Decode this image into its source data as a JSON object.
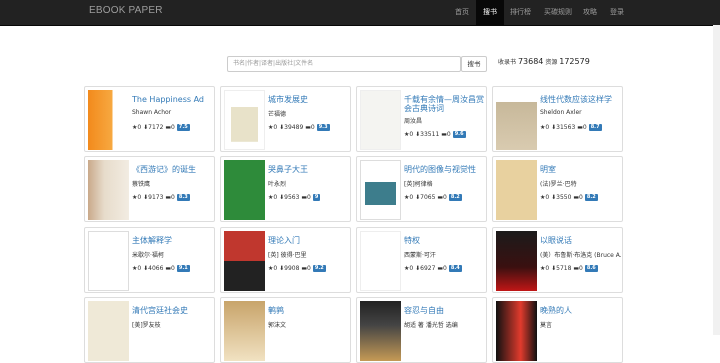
{
  "brand": "EBOOK   PAPER",
  "nav": [
    "首页",
    "搜书",
    "排行榜",
    "买碳规则",
    "攻略",
    "登录"
  ],
  "search": {
    "placeholder": "书名|作者|译者|出版社|文件名",
    "button": "搜书"
  },
  "stats": {
    "books_label": "收录书",
    "books": "73684",
    "resources_label": "资源",
    "resources": "172579"
  },
  "books": [
    {
      "title": "The Happiness Ad",
      "author": "Shawn Achor",
      "stars": "0",
      "downloads": "7172",
      "comments": "0",
      "score": "7.5"
    },
    {
      "title": "城市发展史",
      "author": "芒福德",
      "stars": "0",
      "downloads": "39489",
      "comments": "0",
      "score": "9.3"
    },
    {
      "title": "千载有余情—周汝昌赏会古典诗词",
      "author": "周汝昌",
      "stars": "0",
      "downloads": "33511",
      "comments": "0",
      "score": "9.6"
    },
    {
      "title": "线性代数应该这样学",
      "author": "Sheldon Axler",
      "stars": "0",
      "downloads": "31563",
      "comments": "0",
      "score": "8.7"
    },
    {
      "title": "《西游记》的诞生",
      "author": "蔡铁鹰",
      "stars": "0",
      "downloads": "9173",
      "comments": "0",
      "score": "8.3"
    },
    {
      "title": "哭鼻子大王",
      "author": "叶永烈",
      "stars": "0",
      "downloads": "9563",
      "comments": "0",
      "score": "9"
    },
    {
      "title": "明代的图像与视觉性",
      "author": "[英]柯律格",
      "stars": "0",
      "downloads": "7065",
      "comments": "0",
      "score": "8.2"
    },
    {
      "title": "明室",
      "author": "(法)罗兰·巴特",
      "stars": "0",
      "downloads": "3550",
      "comments": "0",
      "score": "8.2"
    },
    {
      "title": "主体解释学",
      "author": "米歇尔·福柯",
      "stars": "0",
      "downloads": "4066",
      "comments": "0",
      "score": "9.1"
    },
    {
      "title": "理论入门",
      "author": "[英] 彼得·巴里",
      "stars": "0",
      "downloads": "9908",
      "comments": "0",
      "score": "9.2"
    },
    {
      "title": "特权",
      "author": "西蒙斯·可汗",
      "stars": "0",
      "downloads": "6927",
      "comments": "0",
      "score": "8.4"
    },
    {
      "title": "以眼说话",
      "author": "(美）布鲁斯·布洛克 (Bruce A.",
      "stars": "0",
      "downloads": "5718",
      "comments": "0",
      "score": "8.6"
    },
    {
      "title": "清代宫廷社会史",
      "author": "[美]罗友枝",
      "stars": "",
      "downloads": "",
      "comments": "",
      "score": ""
    },
    {
      "title": "鹌鹑",
      "author": "郭沫文",
      "stars": "",
      "downloads": "",
      "comments": "",
      "score": ""
    },
    {
      "title": "容忍与自由",
      "author": "胡适 著 潘光哲 选编",
      "stars": "",
      "downloads": "",
      "comments": "",
      "score": ""
    },
    {
      "title": "晚熟的人",
      "author": "莫言",
      "stars": "",
      "downloads": "",
      "comments": "",
      "score": ""
    }
  ]
}
